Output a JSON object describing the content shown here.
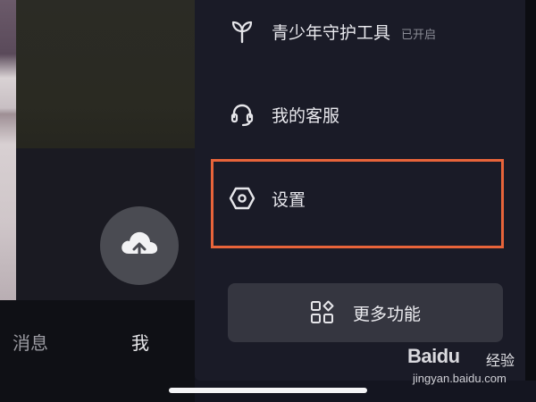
{
  "drawer": {
    "items": [
      {
        "label": "青少年守护工具",
        "badge": "已开启",
        "icon": "sprout-icon"
      },
      {
        "label": "我的客服",
        "icon": "headset-icon"
      },
      {
        "label": "设置",
        "icon": "hexagon-gear-icon"
      }
    ],
    "more_button": {
      "label": "更多功能",
      "icon": "apps-grid-icon"
    }
  },
  "tabbar": {
    "tabs": [
      {
        "label": "消息"
      },
      {
        "label": "我"
      }
    ]
  },
  "upload_button": {
    "icon": "cloud-upload-icon"
  },
  "watermark": {
    "brand": "Baidu",
    "brand_cn": "经验",
    "url": "jingyan.baidu.com"
  },
  "colors": {
    "highlight": "#e8643a",
    "drawer_bg": "#1a1b27",
    "button_bg": "#353640"
  }
}
